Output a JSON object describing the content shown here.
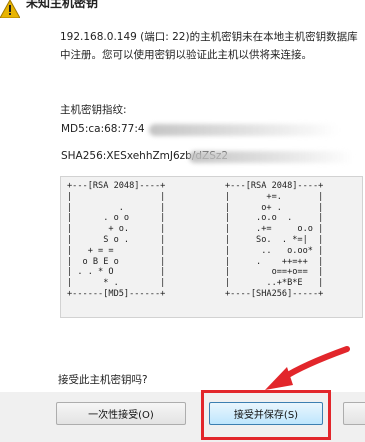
{
  "dialog": {
    "title": "未知主机密钥",
    "message": "192.168.0.149 (端口: 22)的主机密钥未在本地主机密钥数据库中注册。您可以使用密钥以验证此主机以供将来连接。",
    "fingerprint_label": "主机密钥指纹:",
    "md5_visible": "MD5:ca:68:77:4",
    "sha256_visible": "SHA256:XESxehhZmJ6zb/dZSz2",
    "randomart_md5": "+---[RSA 2048]----+\n|                 |\n|         .       |\n|      . o o      |\n|       + o.      |\n|      S o .      |\n|   + = =         |\n|  o B E o        |\n| . . * O         |\n|      * .        |\n+------[MD5]------+",
    "randomart_sha256": "+---[RSA 2048]----+\n|       +=.       |\n|      o+ .       |\n|     .o.o  .     |\n|     .+=     o.o |\n|     So.  . *=|  |\n|      ..   o.oo* |\n|     .    ++=++  |\n|        o==+o==  |\n|       ..+*B*E   |\n+----[SHA256]-----+",
    "question": "接受此主机密钥吗?"
  },
  "buttons": {
    "accept_once": "一次性接受(O)",
    "accept_save": "接受并保存(S)"
  },
  "colors": {
    "highlight": "#e2262b",
    "panel_bg": "#f2f2f2"
  }
}
